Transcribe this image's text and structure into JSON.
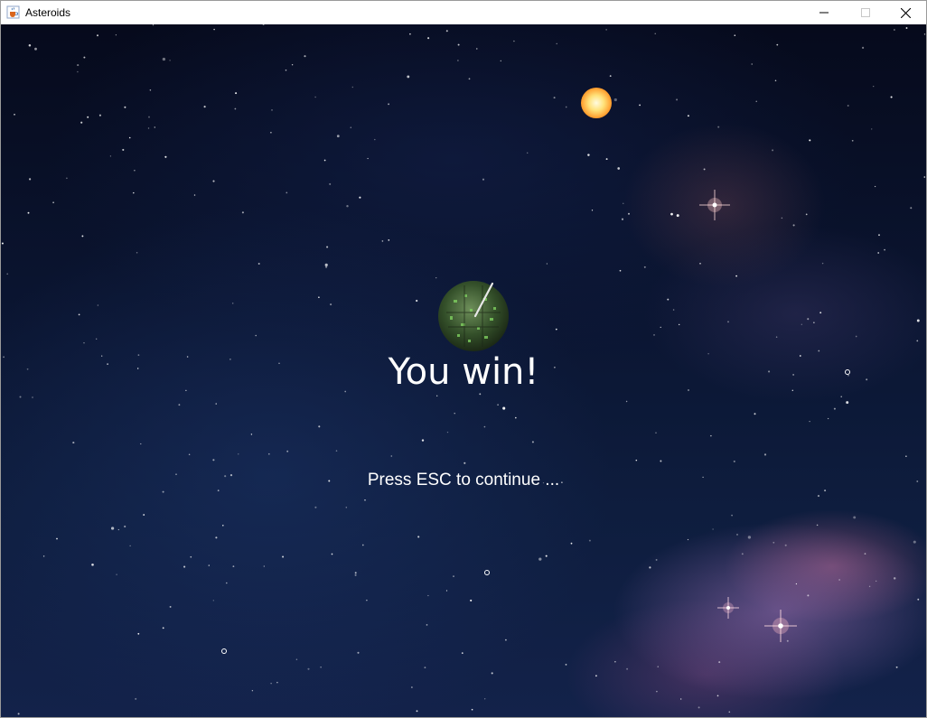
{
  "window": {
    "title": "Asteroids",
    "icon": "java-cup-icon",
    "controls": {
      "minimize_icon": "minimize-icon",
      "maximize_icon": "maximize-icon",
      "close_icon": "close-icon"
    }
  },
  "game": {
    "win_message": "You win!",
    "prompt": "Press ESC to continue ...",
    "colors": {
      "text": "#ffffff",
      "sun": "#ffb23a",
      "ship": "#3f6b2a"
    }
  }
}
